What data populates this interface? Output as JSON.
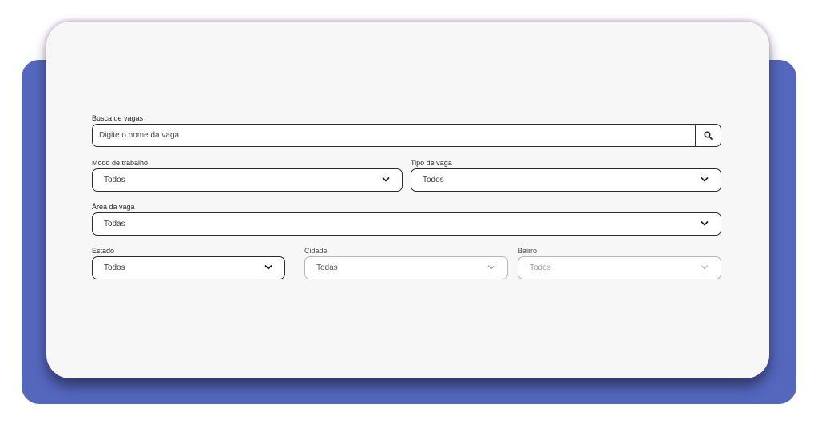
{
  "search": {
    "label": "Busca de vagas",
    "placeholder": "Digite o nome da vaga",
    "value": ""
  },
  "filters": {
    "modo": {
      "label": "Modo de trabalho",
      "value": "Todos"
    },
    "tipo": {
      "label": "Tipo de vaga",
      "value": "Todos"
    },
    "area": {
      "label": "Área da vaga",
      "value": "Todas"
    },
    "estado": {
      "label": "Estado",
      "value": "Todos"
    },
    "cidade": {
      "label": "Cidade",
      "value": "Todas"
    },
    "bairro": {
      "label": "Bairro",
      "value": "Todos"
    }
  },
  "colors": {
    "accent_backdrop": "#5467bd",
    "card_background": "#f7f7f7",
    "border": "#2c2c2c"
  },
  "icons": {
    "search": "search-icon",
    "dropdown": "chevron-down-icon"
  }
}
